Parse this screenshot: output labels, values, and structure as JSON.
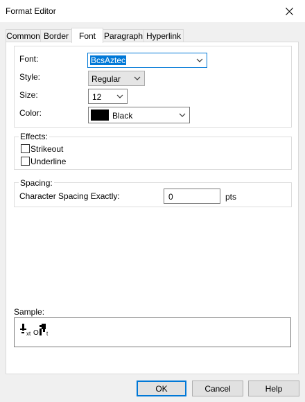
{
  "window": {
    "title": "Format Editor"
  },
  "tabs": [
    {
      "label": "Common"
    },
    {
      "label": "Border"
    },
    {
      "label": "Font"
    },
    {
      "label": "Paragraph"
    },
    {
      "label": "Hyperlink"
    }
  ],
  "font": {
    "font_label": "Font:",
    "font_value": "BcsAztec",
    "style_label": "Style:",
    "style_value": "Regular",
    "size_label": "Size:",
    "size_value": "12",
    "color_label": "Color:",
    "color_value": "Black",
    "color_swatch": "#000000"
  },
  "effects": {
    "title": "Effects:",
    "strikeout": {
      "label": "Strikeout",
      "checked": false
    },
    "underline": {
      "label": "Underline",
      "checked": false
    }
  },
  "spacing": {
    "title": "Spacing:",
    "char_label": "Character Spacing Exactly:",
    "char_value": "0",
    "unit": "pts"
  },
  "sample": {
    "label": "Sample:"
  },
  "buttons": {
    "ok": "OK",
    "cancel": "Cancel",
    "help": "Help"
  },
  "icons": {
    "close": "close-icon",
    "dropdown": "chevron-down-icon"
  },
  "colors": {
    "accent": "#0078d7"
  }
}
